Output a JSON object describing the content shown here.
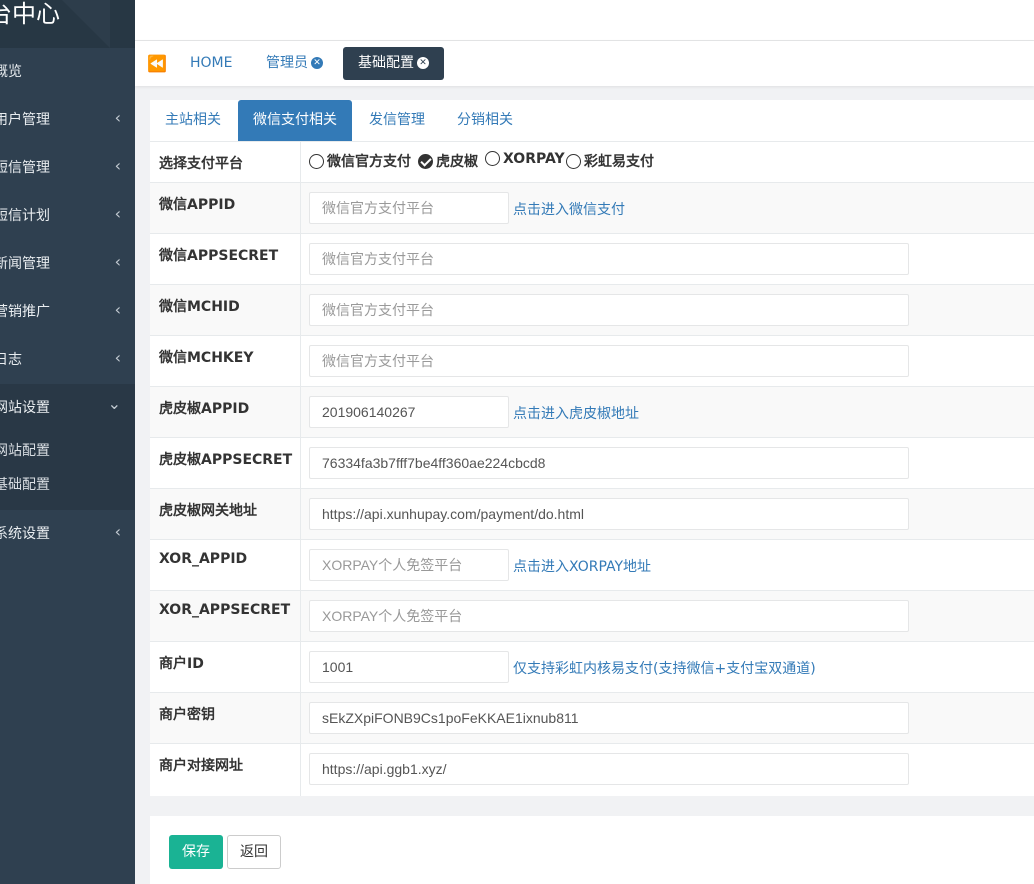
{
  "app": {
    "title": "台中心"
  },
  "sidebar": {
    "items": [
      {
        "label": "概览"
      },
      {
        "label": "用户管理"
      },
      {
        "label": "短信管理"
      },
      {
        "label": "短信计划"
      },
      {
        "label": "新闻管理"
      },
      {
        "label": "营销推广"
      },
      {
        "label": "日志"
      },
      {
        "label": "网站设置"
      },
      {
        "label": "系统设置"
      }
    ],
    "subitems": [
      {
        "label": "网站配置"
      },
      {
        "label": "基础配置"
      }
    ],
    "chevron": "‹",
    "chevron_open": "⌄"
  },
  "tabs": {
    "left_icon": "⏪",
    "home": "HOME",
    "admin": "管理员",
    "active": "基础配置",
    "close_glyph": "✕"
  },
  "subtabs": [
    "主站相关",
    "微信支付相关",
    "发信管理",
    "分销相关"
  ],
  "form": {
    "platform_label": "选择支付平台",
    "options": [
      {
        "label": "微信官方支付",
        "checked": false
      },
      {
        "label": "虎皮椒",
        "checked": true
      },
      {
        "label": "XORPAY",
        "checked": false
      },
      {
        "label": "彩虹易支付",
        "checked": false
      }
    ],
    "rows": [
      {
        "label": "微信APPID",
        "value": "",
        "placeholder": "微信官方支付平台",
        "hint": "点击进入微信支付"
      },
      {
        "label": "微信APPSECRET",
        "value": "",
        "placeholder": "微信官方支付平台"
      },
      {
        "label": "微信MCHID",
        "value": "",
        "placeholder": "微信官方支付平台"
      },
      {
        "label": "微信MCHKEY",
        "value": "",
        "placeholder": "微信官方支付平台"
      },
      {
        "label": "虎皮椒APPID",
        "value": "201906140267",
        "hint": "点击进入虎皮椒地址"
      },
      {
        "label": "虎皮椒APPSECRET",
        "value": "76334fa3b7fff7be4ff360ae224cbcd8"
      },
      {
        "label": "虎皮椒网关地址",
        "value": "https://api.xunhupay.com/payment/do.html"
      },
      {
        "label": "XOR_APPID",
        "value": "",
        "placeholder": "XORPAY个人免签平台",
        "hint": "点击进入XORPAY地址"
      },
      {
        "label": "XOR_APPSECRET",
        "value": "",
        "placeholder": "XORPAY个人免签平台"
      },
      {
        "label": "商户ID",
        "value": "1001",
        "hint": "仅支持彩虹内核易支付(支持微信+支付宝双通道)"
      },
      {
        "label": "商户密钥",
        "value": "sEkZXpiFONB9Cs1poFeKKAE1ixnub811"
      },
      {
        "label": "商户对接网址",
        "value": "https://api.ggb1.xyz/"
      }
    ]
  },
  "buttons": {
    "save": "保存",
    "back": "返回"
  },
  "colors": {
    "sidebar": "#2f4050",
    "link": "#337ab7",
    "save": "#1ab394"
  }
}
